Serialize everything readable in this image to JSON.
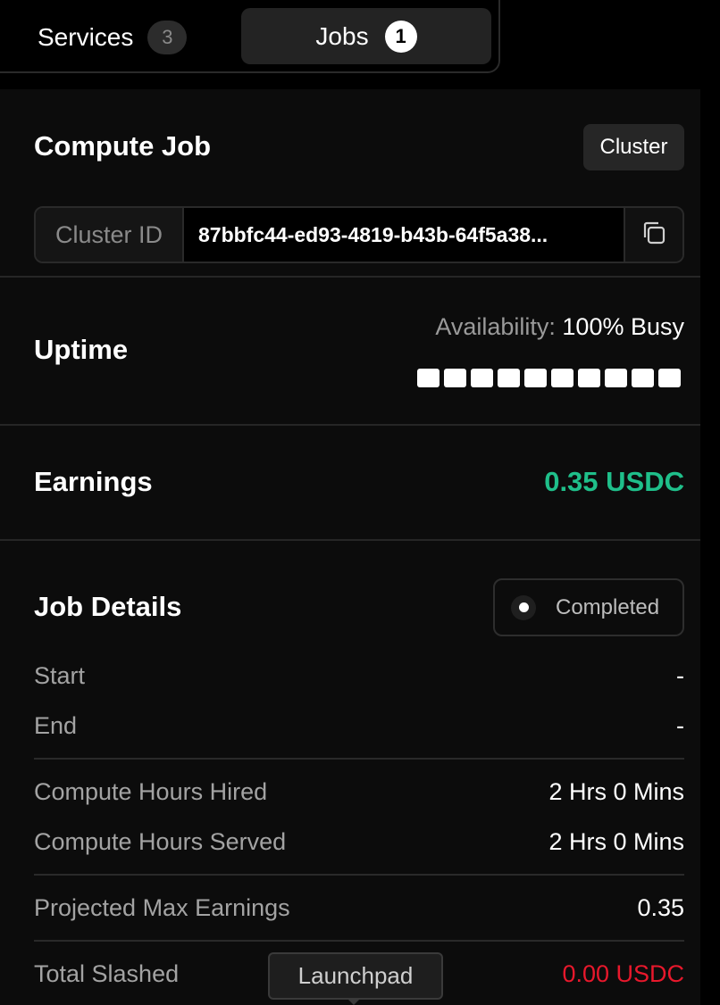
{
  "tabs": {
    "services": {
      "label": "Services",
      "count": "3"
    },
    "jobs": {
      "label": "Jobs",
      "count": "1"
    }
  },
  "compute_job": {
    "title": "Compute Job",
    "cluster_button": "Cluster",
    "cluster_id_label": "Cluster ID",
    "cluster_id_value": "87bbfc44-ed93-4819-b43b-64f5a38...",
    "copy_icon": "copy-icon"
  },
  "uptime": {
    "title": "Uptime",
    "availability_label": "Availability:",
    "availability_value": "100% Busy",
    "bars_filled": 10,
    "bars_total": 10
  },
  "earnings": {
    "title": "Earnings",
    "value": "0.35 USDC",
    "color": "#1fbf8a"
  },
  "job_details": {
    "title": "Job Details",
    "status": "Completed",
    "rows": [
      {
        "key": "Start",
        "value": "-"
      },
      {
        "key": "End",
        "value": "-"
      },
      {
        "key": "Compute Hours Hired",
        "value": "2 Hrs 0 Mins"
      },
      {
        "key": "Compute Hours Served",
        "value": "2 Hrs 0 Mins"
      },
      {
        "key": "Projected Max Earnings",
        "value": "0.35"
      },
      {
        "key": "Total Slashed",
        "value": "0.00 USDC"
      }
    ]
  },
  "tooltip": {
    "text": "Launchpad"
  },
  "colors": {
    "slashed": "#e8182c",
    "accent_green": "#1fbf8a"
  }
}
